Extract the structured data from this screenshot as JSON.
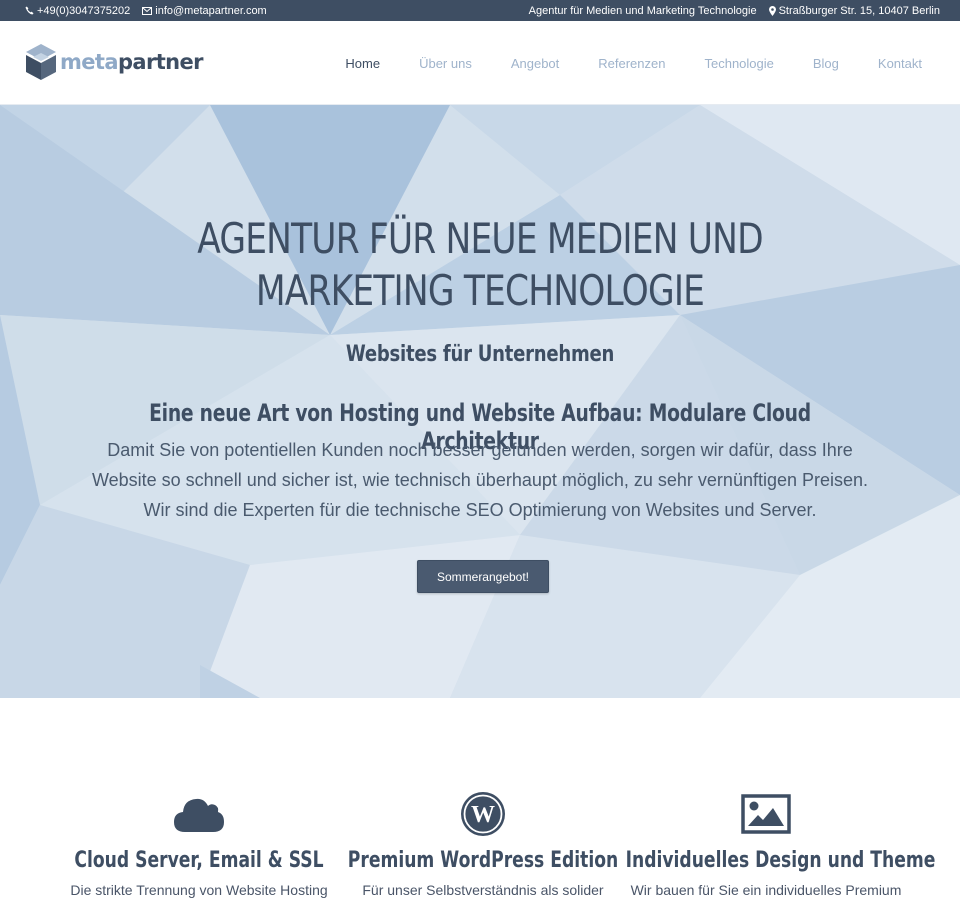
{
  "topbar": {
    "phone": "+49(0)3047375202",
    "email": "info@metapartner.com",
    "tagline": "Agentur für Medien und Marketing Technologie",
    "address": "Straßburger Str. 15, 10407 Berlin"
  },
  "logo": {
    "part1": "meta",
    "part2": "partner"
  },
  "nav": [
    {
      "label": "Home"
    },
    {
      "label": "Über uns"
    },
    {
      "label": "Angebot"
    },
    {
      "label": "Referenzen"
    },
    {
      "label": "Technologie"
    },
    {
      "label": "Blog"
    },
    {
      "label": "Kontakt"
    }
  ],
  "hero": {
    "title": "AGENTUR FÜR NEUE MEDIEN UND MARKETING TECHNOLOGIE",
    "subtitle": "Websites für Unternehmen",
    "heading": "Eine neue Art von Hosting und Website Aufbau: Modulare Cloud Architektur",
    "lead": "Damit Sie von potentiellen Kunden noch besser gefunden werden, sorgen wir dafür, dass Ihre Website so schnell und sicher ist, wie technisch überhaupt möglich, zu sehr vernünftigen Preisen. Wir sind die Experten für die technische SEO Optimierung von Websites und Server.",
    "button": "Sommerangebot!"
  },
  "features": [
    {
      "icon": "cloud-icon",
      "title": "Cloud Server, Email & SSL",
      "desc": "Die strikte Trennung von Website Hosting"
    },
    {
      "icon": "wordpress-icon",
      "title": "Premium WordPress Edition",
      "desc": "Für unser Selbstverständnis als solider"
    },
    {
      "icon": "image-icon",
      "title": "Individuelles Design und Theme",
      "desc": "Wir bauen für Sie ein individuelles Premium"
    }
  ],
  "colors": {
    "dark": "#3e4e63",
    "accent": "#8fa9c7",
    "hero_bg": "#d4e0ec"
  }
}
